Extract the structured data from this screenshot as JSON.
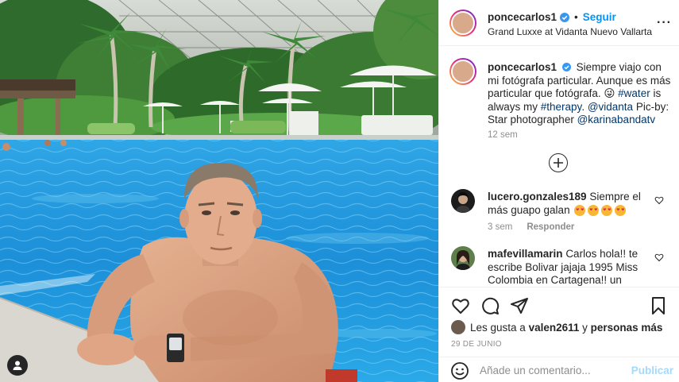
{
  "post": {
    "username": "poncecarlos1",
    "follow_label": "Seguir",
    "separator": "•",
    "location": "Grand Luxxe at Vidanta Nuevo Vallarta",
    "more_label": "···"
  },
  "caption": {
    "username": "poncecarlos1",
    "text_1": "Siempre viajo con mi fotógrafa particular. Aunque es más particular que fotógrafa. 😜 ",
    "tag_water": "#water",
    "text_2": " is always my ",
    "tag_therapy": "#therapy",
    "text_3": ". ",
    "tag_vidanta": "@vidanta",
    "text_4": " Pic-by: Star photographer ",
    "tag_karina": "@karinabandatv",
    "time": "12 sem"
  },
  "comments": [
    {
      "username": "lucero.gonzales189",
      "text": "Siempre el más guapo galan",
      "emoji_count": 4,
      "time": "3 sem",
      "reply_label": "Responder"
    },
    {
      "username": "mafevillamarin",
      "text": "Carlos hola!! te escribe Bolivar jajaja 1995 Miss Colombia en Cartagena!! un"
    }
  ],
  "likes": {
    "prefix": "Les gusta a ",
    "user": "valen2611",
    "joiner": " y ",
    "others": "personas más"
  },
  "date": "29 DE JUNIO",
  "add_comment": {
    "placeholder": "Añade un comentario...",
    "publish_label": "Publicar"
  },
  "colors": {
    "accent": "#0095f6",
    "tag": "#00376b",
    "muted": "#8e8e8e",
    "border": "#efefef"
  },
  "icons": [
    "user-tag-icon",
    "verified-badge-icon",
    "more-options-icon",
    "load-more-icon",
    "heart-icon",
    "comment-icon",
    "share-icon",
    "save-icon",
    "emoji-icon"
  ]
}
